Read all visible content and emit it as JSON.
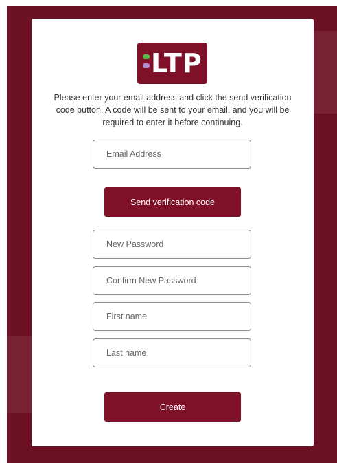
{
  "logo": {
    "text": "LTP",
    "colors": {
      "background": "#7e1028",
      "bar_green": "#58b848",
      "bar_purple": "#b28ad0"
    }
  },
  "intro_text": "Please enter your email address and click the send verification code button. A code will be sent to your email, and you will be required to enter it before continuing.",
  "fields": {
    "email": {
      "placeholder": "Email Address",
      "value": ""
    },
    "new_password": {
      "placeholder": "New Password",
      "value": ""
    },
    "confirm_password": {
      "placeholder": "Confirm New Password",
      "value": ""
    },
    "first_name": {
      "placeholder": "First name",
      "value": ""
    },
    "last_name": {
      "placeholder": "Last name",
      "value": ""
    }
  },
  "buttons": {
    "send_code": "Send verification code",
    "create": "Create"
  },
  "theme": {
    "brand": "#7e1028",
    "page_background": "#6b1022"
  }
}
